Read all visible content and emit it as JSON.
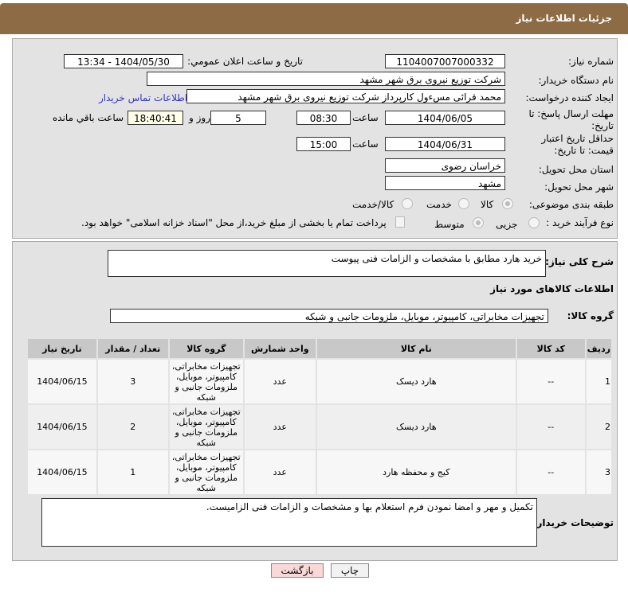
{
  "header": {
    "title": "جزئیات اطلاعات نیاز"
  },
  "form": {
    "need_number_label": "شماره نیاز:",
    "need_number": "1104007007000332",
    "announce_label": "تاریخ و ساعت اعلان عمومي:",
    "announce_value": "1404/05/30 - 13:34",
    "buyer_label": "نام دستگاه خریدار:",
    "buyer": "شرکت توزیع نیروی برق شهر مشهد",
    "creator_label": "ایجاد کننده درخواست:",
    "creator": "محمد قرائی مسءول کارپرداز شرکت توزیع نیروی برق شهر مشهد",
    "contact_link": "اطلاعات تماس خریدار",
    "deadline_label": "مهلت ارسال پاسخ: تا تاریخ:",
    "deadline_date": "1404/06/05",
    "time_label": "ساعت",
    "deadline_time": "08:30",
    "days": "5",
    "days_label": "روز و",
    "remaining": "18:40:41",
    "remaining_label": "ساعت باقي مانده",
    "validity_label": "حداقل تاریخ اعتبار قیمت: تا تاریخ:",
    "validity_date": "1404/06/31",
    "validity_time": "15:00",
    "province_label": "استان محل تحویل:",
    "province": "خراسان رضوی",
    "city_label": "شهر محل تحویل:",
    "city": "مشهد",
    "category_label": "طبقه بندی موضوعی:",
    "category_options": [
      "کالا",
      "خدمت",
      "کالا/خدمت"
    ],
    "process_label": "نوع فرآیند خرید :",
    "process_options": [
      "جزیی",
      "متوسط"
    ],
    "payment_note": "پرداخت تمام یا بخشی از مبلغ خرید،از محل \"اسناد خزانه اسلامی\" خواهد بود."
  },
  "summary": {
    "label": "شرح کلی نیاز:",
    "value": "خرید هارد مطابق با مشخصات و الزامات فنی پیوست"
  },
  "goods": {
    "section_title": "اطلاعات کالاهای مورد نیاز",
    "group_label": "گروه کالا:",
    "group_value": "تجهیزات مخابراتی، کامپیوتر، موبایل، ملزومات جانبی و شبکه",
    "columns": [
      "ردیف",
      "کد کالا",
      "نام کالا",
      "واحد شمارش",
      "گروه کالا",
      "تعداد / مقدار",
      "تاریخ نیاز"
    ],
    "rows": [
      [
        "1",
        "--",
        "هارد دیسک",
        "عدد",
        "تجهیزات مخابراتی، کامپیوتر، موبایل، ملزومات جانبی و شبکه",
        "3",
        "1404/06/15"
      ],
      [
        "2",
        "--",
        "هارد دیسک",
        "عدد",
        "تجهیزات مخابراتی، کامپیوتر، موبایل، ملزومات جانبی و شبکه",
        "2",
        "1404/06/15"
      ],
      [
        "3",
        "--",
        "کیج و محفظه هارد",
        "عدد",
        "تجهیزات مخابراتی، کامپیوتر، موبایل، ملزومات جانبی و شبکه",
        "1",
        "1404/06/15"
      ]
    ]
  },
  "notes": {
    "label": "توضیحات خریدار:",
    "value": "تکمیل و مهر و امضا نمودن فرم استعلام بها و مشخصات و الزامات فنی الزامیست."
  },
  "buttons": {
    "print": "چاپ",
    "back": "بازگشت"
  }
}
